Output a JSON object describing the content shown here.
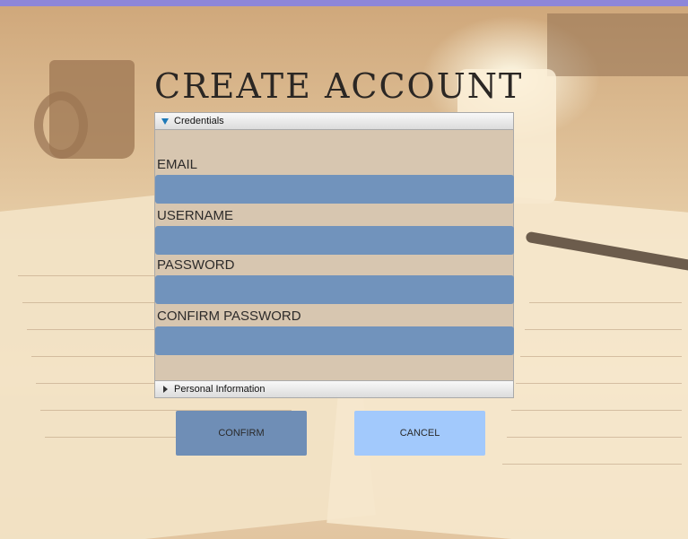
{
  "page": {
    "title": "CREATE ACCOUNT"
  },
  "credentials": {
    "header_label": "Credentials",
    "fields": [
      {
        "label": "EMAIL",
        "value": ""
      },
      {
        "label": "USERNAME",
        "value": ""
      },
      {
        "label": "PASSWORD",
        "value": ""
      },
      {
        "label": "CONFIRM PASSWORD",
        "value": ""
      }
    ]
  },
  "personal_information": {
    "header_label": "Personal Information",
    "expanded": false
  },
  "buttons": {
    "confirm_label": "CONFIRM",
    "cancel_label": "CANCEL"
  },
  "colors": {
    "titlebar": "#8d86d9",
    "input_bg": "#7193bc",
    "panel_bg": "#d7c6b0",
    "confirm_bg": "#6f8eb6",
    "cancel_bg": "#a2c9fc",
    "expand_arrow": "#1d79b8"
  },
  "icons": {
    "expanded": "triangle-down-icon",
    "collapsed": "triangle-right-icon"
  }
}
